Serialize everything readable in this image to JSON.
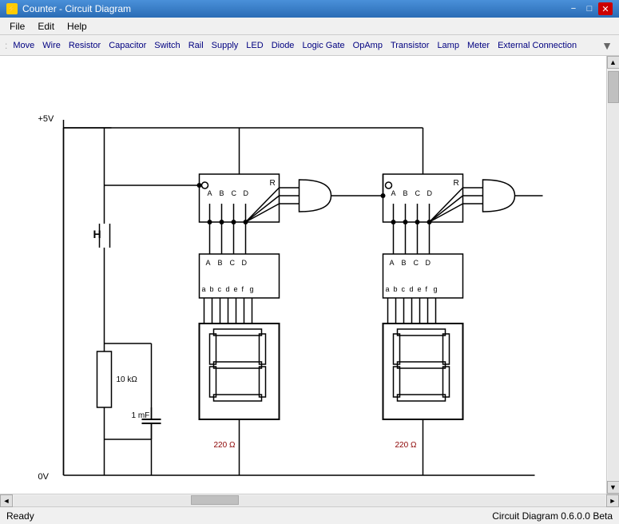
{
  "titleBar": {
    "icon": "⚡",
    "title": "Counter - Circuit Diagram",
    "minimizeLabel": "−",
    "maximizeLabel": "□",
    "closeLabel": "✕"
  },
  "menuBar": {
    "items": [
      "File",
      "Edit",
      "Help"
    ]
  },
  "toolbar": {
    "items": [
      "Move",
      "Wire",
      "Resistor",
      "Capacitor",
      "Switch",
      "Rail",
      "Supply",
      "LED",
      "Diode",
      "Logic Gate",
      "OpAmp",
      "Transistor",
      "Lamp",
      "Meter",
      "External Connection"
    ]
  },
  "statusBar": {
    "left": "Ready",
    "right": "Circuit Diagram 0.6.0.0 Beta"
  },
  "scrollbar": {
    "upArrow": "▲",
    "downArrow": "▼",
    "leftArrow": "◄",
    "rightArrow": "►"
  }
}
